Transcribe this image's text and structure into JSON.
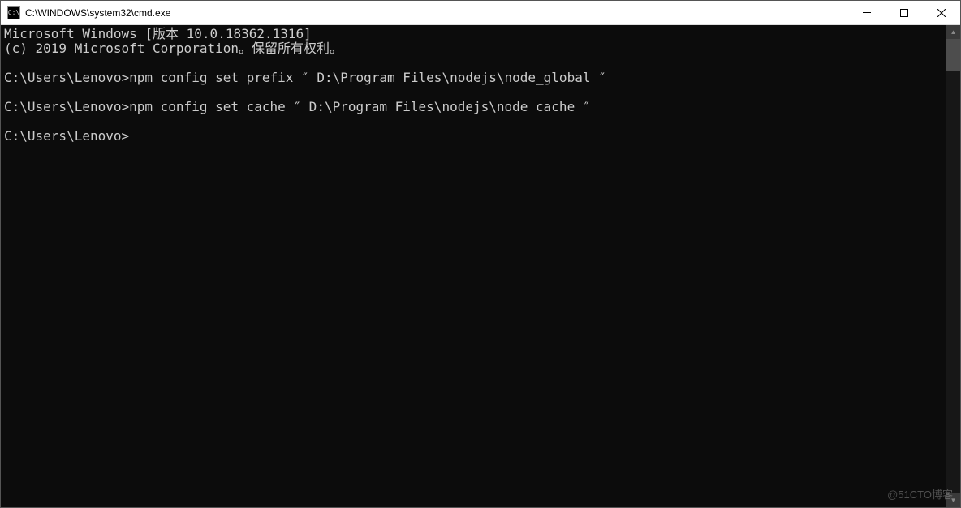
{
  "titlebar": {
    "icon_label": "C:\\",
    "title": "C:\\WINDOWS\\system32\\cmd.exe"
  },
  "terminal": {
    "lines": [
      "Microsoft Windows [版本 10.0.18362.1316]",
      "(c) 2019 Microsoft Corporation。保留所有权利。",
      "",
      "C:\\Users\\Lenovo>npm config set prefix ″ D:\\Program Files\\nodejs\\node_global ″",
      "",
      "C:\\Users\\Lenovo>npm config set cache ″ D:\\Program Files\\nodejs\\node_cache ″",
      "",
      "C:\\Users\\Lenovo>"
    ]
  },
  "watermark": "@51CTO博客"
}
